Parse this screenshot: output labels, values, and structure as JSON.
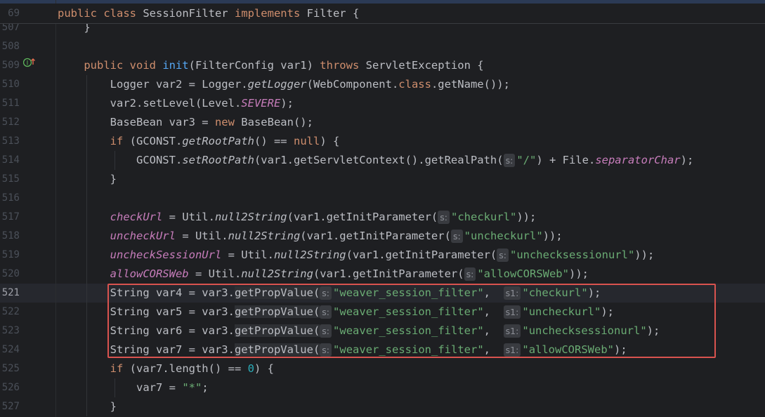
{
  "sticky": {
    "line_no": "69",
    "code": "public class SessionFilter implements Filter {"
  },
  "lines": [
    {
      "n": "507",
      "parts": [
        [
          "",
          "    }"
        ]
      ]
    },
    {
      "n": "508",
      "parts": []
    },
    {
      "n": "509",
      "parts": [
        [
          "",
          "    "
        ],
        [
          "kw",
          "public void "
        ],
        [
          "fn",
          "init"
        ],
        [
          "",
          "(FilterConfig var1) "
        ],
        [
          "kw",
          "throws"
        ],
        [
          "",
          " ServletException {"
        ]
      ]
    },
    {
      "n": "510",
      "parts": [
        [
          "",
          "        Logger var2 = Logger."
        ],
        [
          "it",
          "getLogger"
        ],
        [
          "",
          "(WebComponent."
        ],
        [
          "kw",
          "class"
        ],
        [
          "",
          ".getName());"
        ]
      ]
    },
    {
      "n": "511",
      "parts": [
        [
          "",
          "        var2.setLevel(Level."
        ],
        [
          "sf",
          "SEVERE"
        ],
        [
          "",
          ");"
        ]
      ]
    },
    {
      "n": "512",
      "parts": [
        [
          "",
          "        BaseBean var3 = "
        ],
        [
          "kw",
          "new"
        ],
        [
          "",
          " BaseBean();"
        ]
      ]
    },
    {
      "n": "513",
      "parts": [
        [
          "",
          "        "
        ],
        [
          "kw",
          "if"
        ],
        [
          "",
          " (GCONST."
        ],
        [
          "it",
          "getRootPath"
        ],
        [
          "",
          "() == "
        ],
        [
          "kw",
          "null"
        ],
        [
          "",
          ") {"
        ]
      ]
    },
    {
      "n": "514",
      "parts": [
        [
          "",
          "            GCONST."
        ],
        [
          "it",
          "setRootPath"
        ],
        [
          "",
          "(var1.getServletContext().getRealPath("
        ],
        [
          "hint",
          "s:"
        ],
        [
          "st",
          "\"/\""
        ],
        [
          "",
          ") + File."
        ],
        [
          "sf",
          "separatorChar"
        ],
        [
          "",
          ");"
        ]
      ]
    },
    {
      "n": "515",
      "parts": [
        [
          "",
          "        }"
        ]
      ]
    },
    {
      "n": "516",
      "parts": []
    },
    {
      "n": "517",
      "parts": [
        [
          "",
          "        "
        ],
        [
          "fld",
          "checkUrl"
        ],
        [
          "",
          " = Util."
        ],
        [
          "it",
          "null2String"
        ],
        [
          "",
          "(var1.getInitParameter("
        ],
        [
          "hint",
          "s:"
        ],
        [
          "st",
          "\"checkurl\""
        ],
        [
          "",
          "));"
        ]
      ]
    },
    {
      "n": "518",
      "parts": [
        [
          "",
          "        "
        ],
        [
          "fld",
          "uncheckUrl"
        ],
        [
          "",
          " = Util."
        ],
        [
          "it",
          "null2String"
        ],
        [
          "",
          "(var1.getInitParameter("
        ],
        [
          "hint",
          "s:"
        ],
        [
          "st",
          "\"uncheckurl\""
        ],
        [
          "",
          "));"
        ]
      ]
    },
    {
      "n": "519",
      "parts": [
        [
          "",
          "        "
        ],
        [
          "fld",
          "uncheckSessionUrl"
        ],
        [
          "",
          " = Util."
        ],
        [
          "it",
          "null2String"
        ],
        [
          "",
          "(var1.getInitParameter("
        ],
        [
          "hint",
          "s:"
        ],
        [
          "st",
          "\"unchecksessionurl\""
        ],
        [
          "",
          "));"
        ]
      ]
    },
    {
      "n": "520",
      "parts": [
        [
          "",
          "        "
        ],
        [
          "fld",
          "allowCORSWeb"
        ],
        [
          "",
          " = Util."
        ],
        [
          "it",
          "null2String"
        ],
        [
          "",
          "(var1.getInitParameter("
        ],
        [
          "hint",
          "s:"
        ],
        [
          "st",
          "\"allowCORSWeb\""
        ],
        [
          "",
          "));"
        ]
      ]
    },
    {
      "n": "521",
      "parts": [
        [
          "",
          "        String var4 = var3."
        ],
        [
          "occ",
          "getPropValue("
        ],
        [
          "hint",
          "s:"
        ],
        [
          "st",
          "\"weaver_session_filter\""
        ],
        [
          "",
          ",  "
        ],
        [
          "hint",
          "s1:"
        ],
        [
          "st",
          "\"checkurl\""
        ],
        [
          "",
          ");"
        ]
      ]
    },
    {
      "n": "522",
      "parts": [
        [
          "",
          "        String var5 = var3."
        ],
        [
          "occ",
          "getPropValue("
        ],
        [
          "hint",
          "s:"
        ],
        [
          "st",
          "\"weaver_session_filter\""
        ],
        [
          "",
          ",  "
        ],
        [
          "hint",
          "s1:"
        ],
        [
          "st",
          "\"uncheckurl\""
        ],
        [
          "",
          ");"
        ]
      ]
    },
    {
      "n": "523",
      "parts": [
        [
          "",
          "        String var6 = var3."
        ],
        [
          "occ",
          "getPropValue("
        ],
        [
          "hint",
          "s:"
        ],
        [
          "st",
          "\"weaver_session_filter\""
        ],
        [
          "",
          ",  "
        ],
        [
          "hint",
          "s1:"
        ],
        [
          "st",
          "\"unchecksessionurl\""
        ],
        [
          "",
          ");"
        ]
      ]
    },
    {
      "n": "524",
      "parts": [
        [
          "",
          "        String var7 = var3."
        ],
        [
          "occ",
          "getPropValue("
        ],
        [
          "hint",
          "s:"
        ],
        [
          "st",
          "\"weaver_session_filter\""
        ],
        [
          "",
          ",  "
        ],
        [
          "hint",
          "s1:"
        ],
        [
          "st",
          "\"allowCORSWeb\""
        ],
        [
          "",
          ");"
        ]
      ]
    },
    {
      "n": "525",
      "parts": [
        [
          "",
          "        "
        ],
        [
          "kw",
          "if"
        ],
        [
          "",
          " (var7.length() == "
        ],
        [
          "num",
          "0"
        ],
        [
          "",
          ") {"
        ]
      ]
    },
    {
      "n": "526",
      "parts": [
        [
          "",
          "            var7 = "
        ],
        [
          "st",
          "\"*\""
        ],
        [
          "",
          ";"
        ]
      ]
    },
    {
      "n": "527",
      "parts": [
        [
          "",
          "        }"
        ]
      ]
    }
  ],
  "current_line": "521",
  "gutter_icon": "override-implements-icon"
}
